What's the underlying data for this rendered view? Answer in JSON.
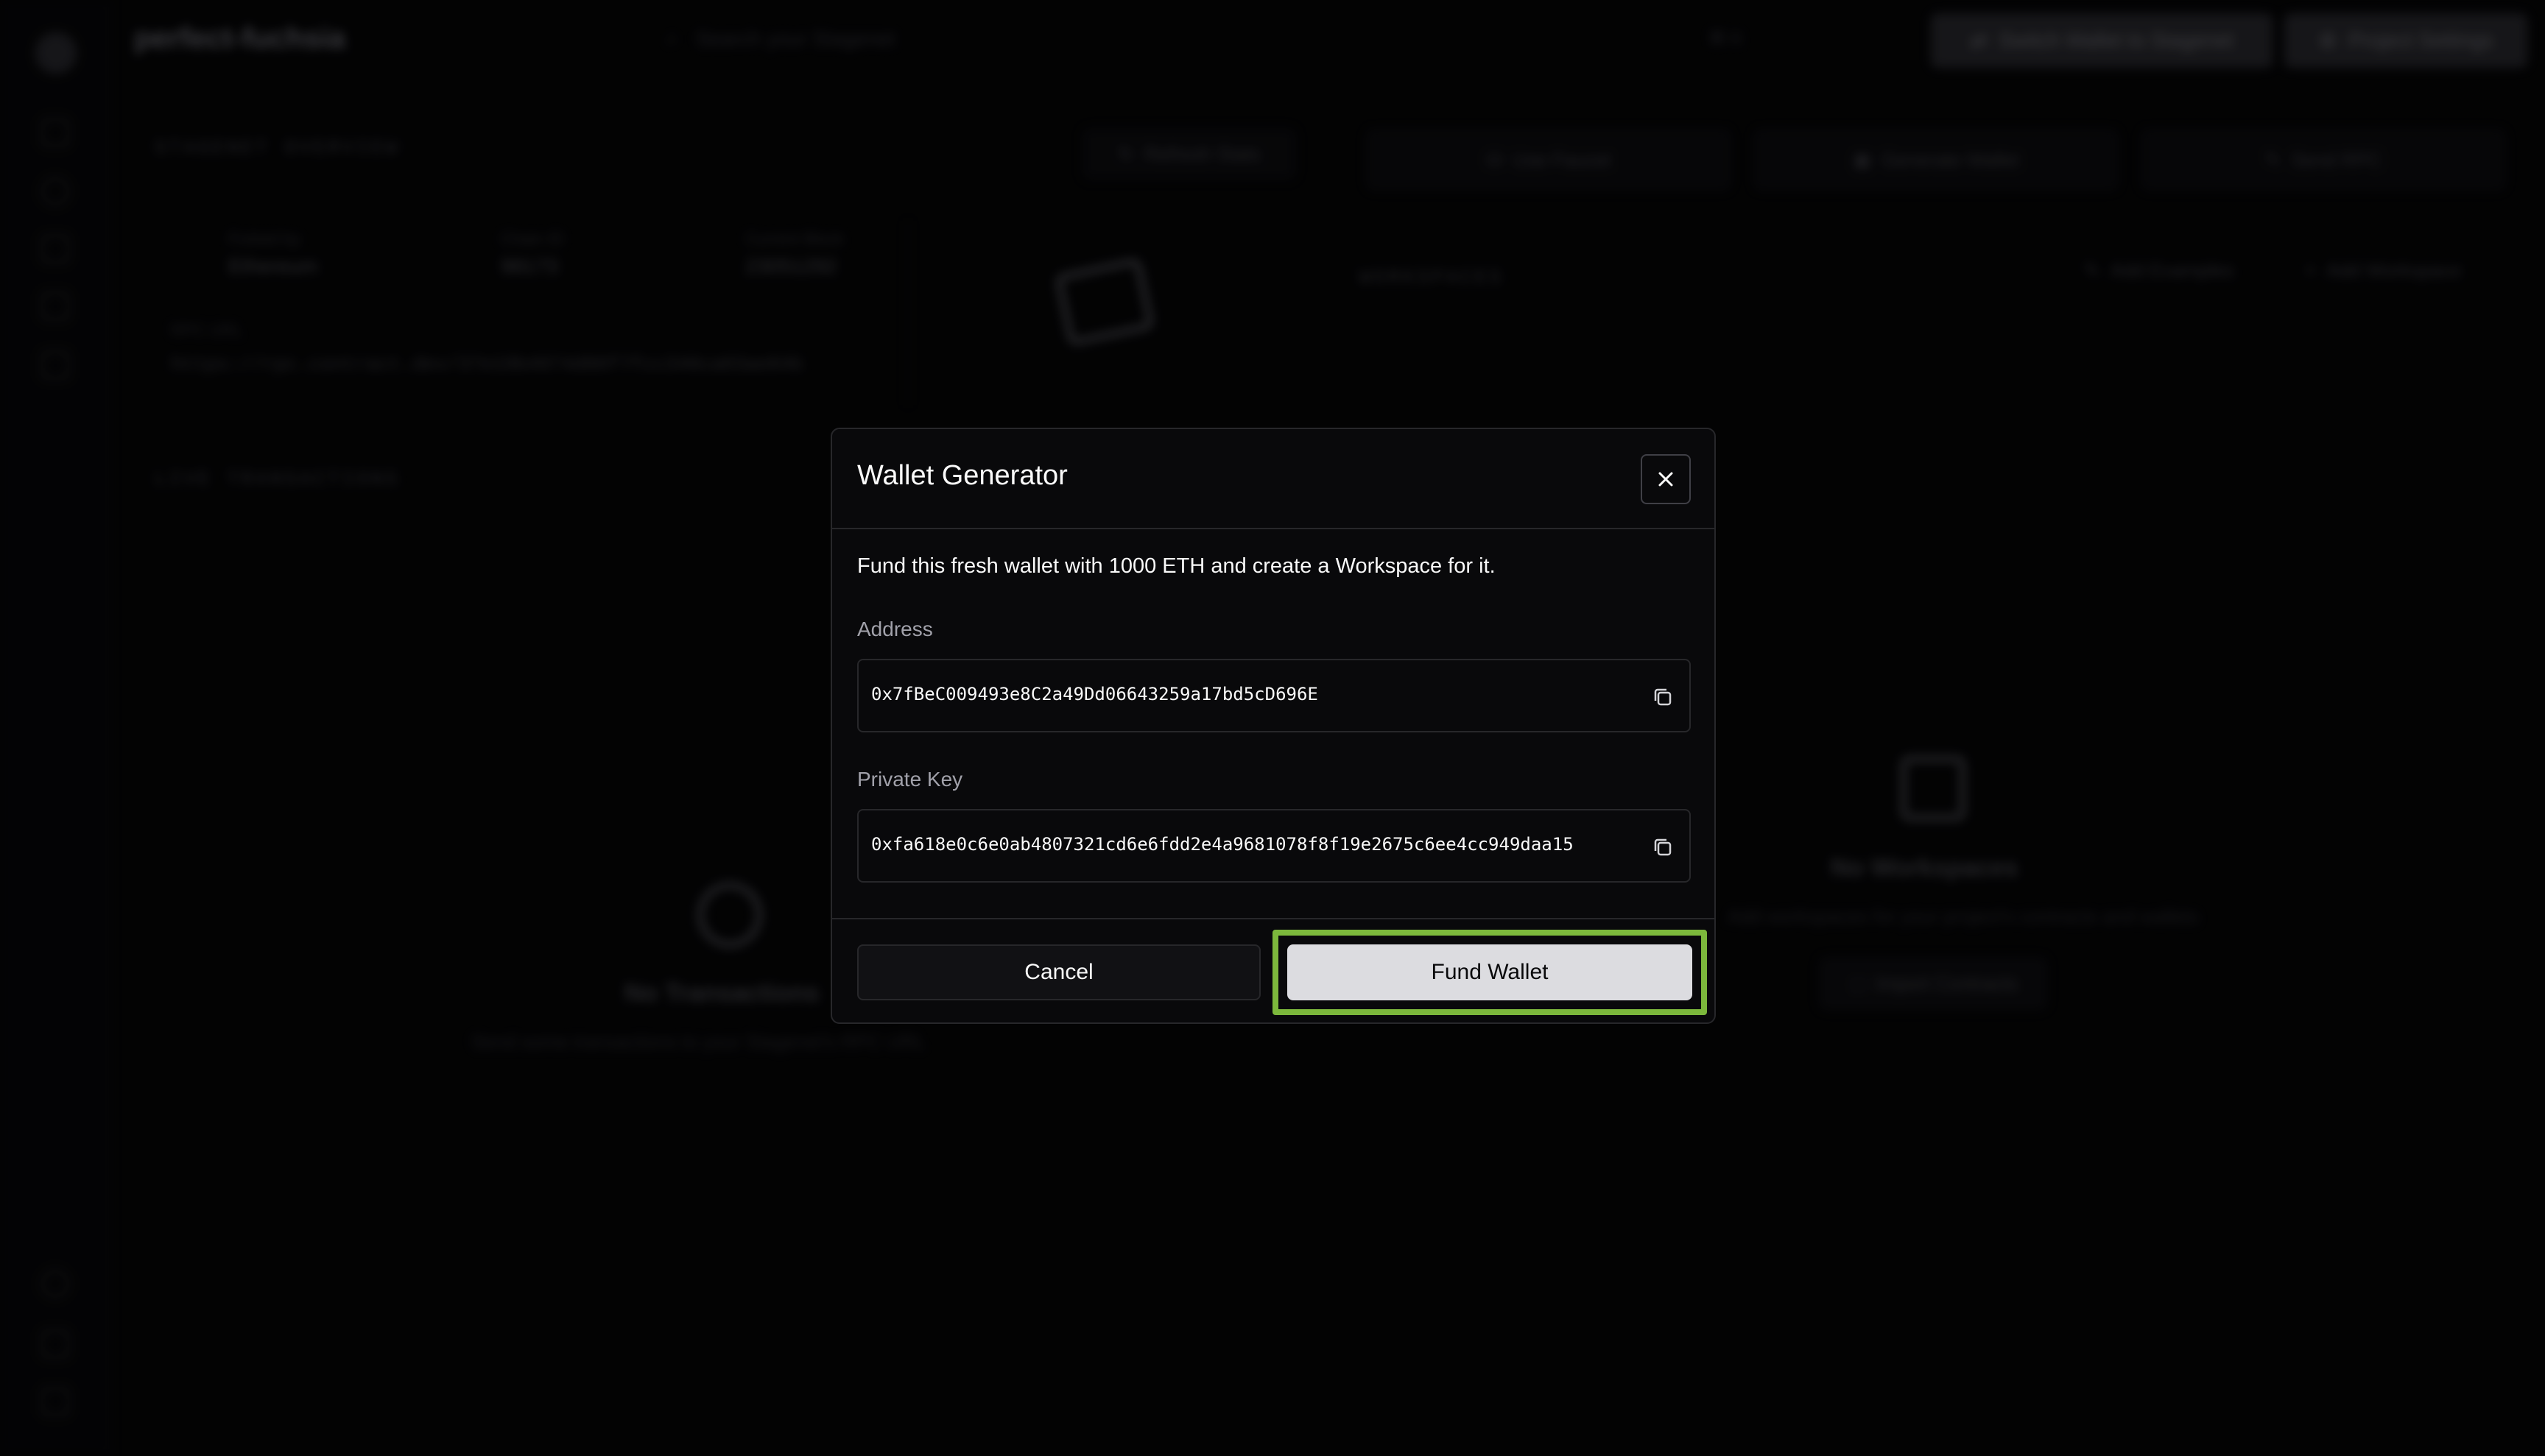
{
  "background": {
    "project_name": "perfect-fuchsia",
    "search_placeholder": "Search your Stagenet",
    "shortcut": "⌘ K",
    "top_buttons": [
      "Switch Wallet to Stagenet",
      "Project Settings"
    ],
    "overview_label": "STAGENET OVERVIEW",
    "refresh_button": "Refresh Stats",
    "stats": [
      {
        "key": "Forked by",
        "value": "Ethereum"
      },
      {
        "key": "Chain ID",
        "value": "98173"
      },
      {
        "key": "Current Block",
        "value": "23051292"
      }
    ],
    "rpc_label": "RPC URL",
    "rpc_url": "https://rpc.contract.dev/37e19b4974d00f7fcc340ca03ae84b",
    "action_buttons": [
      "Use Faucet",
      "Generate Wallet",
      "Send RPC"
    ],
    "workspaces_label": "WORKSPACES",
    "add_examples": "Add Examples",
    "add_workspace": "Add Workspace",
    "live_tx_label": "LIVE TRANSACTIONS",
    "no_tx_title": "No Transactions",
    "no_tx_sub": "Send some transactions to your Stagenet's RPC URL",
    "no_ws_title": "No Workspaces",
    "no_ws_sub": "Add workspaces for your project's contracts and wallets",
    "import_contracts": "Import Contracts"
  },
  "modal": {
    "title": "Wallet Generator",
    "description": "Fund this fresh wallet with 1000 ETH and create a Workspace for it.",
    "address_label": "Address",
    "address_value": "0x7fBeC009493e8C2a49Dd06643259a17bd5cD696E",
    "private_key_label": "Private Key",
    "private_key_value": "0xfa618e0c6e0ab4807321cd6e6fdd2e4a9681078f8f19e2675c6ee4cc949daa15",
    "cancel_label": "Cancel",
    "fund_label": "Fund Wallet"
  },
  "colors": {
    "highlight": "#7cb83c",
    "primary_button": "#dcdce0",
    "modal_background": "#09090b"
  },
  "icons": [
    "close-icon",
    "copy-icon"
  ]
}
